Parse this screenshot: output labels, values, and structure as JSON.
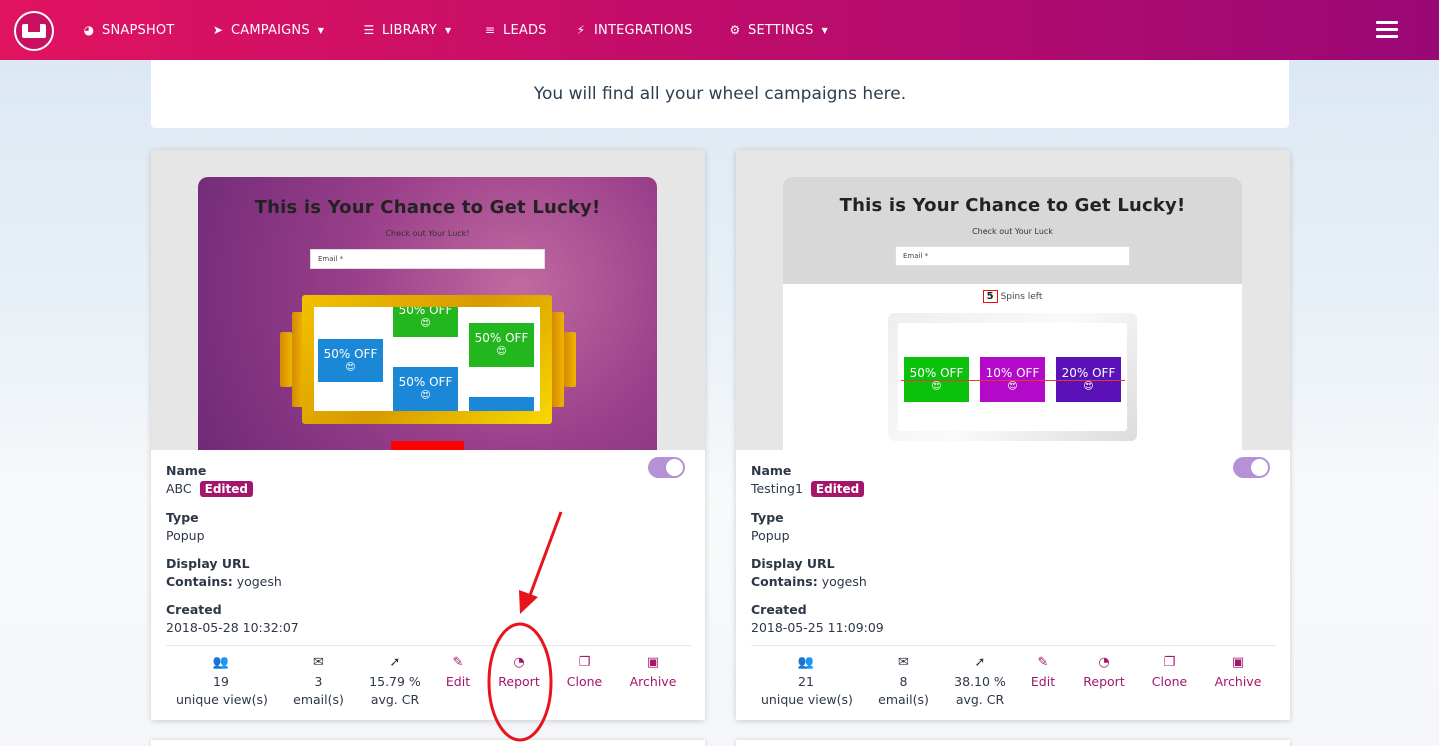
{
  "nav": {
    "items": [
      {
        "label": "SNAPSHOT",
        "icon": "dashboard-icon"
      },
      {
        "label": "CAMPAIGNS",
        "icon": "paper-plane-icon"
      },
      {
        "label": "LIBRARY",
        "icon": "server-icon"
      },
      {
        "label": "LEADS",
        "icon": "list-icon"
      },
      {
        "label": "INTEGRATIONS",
        "icon": "plug-icon"
      },
      {
        "label": "SETTINGS",
        "icon": "cogs-icon"
      }
    ]
  },
  "banner": {
    "text": "You will find all your wheel campaigns here."
  },
  "labels": {
    "name": "Name",
    "type": "Type",
    "display_url": "Display URL",
    "contains": "Contains:",
    "created": "Created",
    "edited": "Edited"
  },
  "cards": [
    {
      "name": "ABC",
      "type": "Popup",
      "contains": "yogesh",
      "created": "2018-05-28 10:32:07",
      "enabled": true,
      "preview": {
        "title": "This is Your Chance to Get Lucky!",
        "subtitle": "Check out Your Luck!",
        "email_placeholder": "Email *",
        "prizes": [
          "50% OFF",
          "50% OFF",
          "50% OFF",
          "50% OFF"
        ],
        "emoji": "😍"
      },
      "stats": {
        "views": "19",
        "views_label": "unique view(s)",
        "emails": "3",
        "emails_label": "email(s)",
        "cr": "15.79 %",
        "cr_label": "avg. CR"
      }
    },
    {
      "name": "Testing1",
      "type": "Popup",
      "contains": "yogesh",
      "created": "2018-05-25 11:09:09",
      "enabled": true,
      "preview": {
        "title": "This is Your Chance to Get Lucky!",
        "subtitle": "Check out Your Luck",
        "email_placeholder": "Email *",
        "spins_count": "5",
        "spins_label": "Spins left",
        "prizes": [
          "50% OFF",
          "10% OFF",
          "20% OFF"
        ],
        "emoji": "😍"
      },
      "stats": {
        "views": "21",
        "views_label": "unique view(s)",
        "emails": "8",
        "emails_label": "email(s)",
        "cr": "38.10 %",
        "cr_label": "avg. CR"
      }
    }
  ],
  "actions": {
    "edit": "Edit",
    "report": "Report",
    "clone": "Clone",
    "archive": "Archive"
  },
  "colors": {
    "nav_start": "#e0135f",
    "nav_end": "#9a0876",
    "accent": "#a3166a",
    "toggle": "#b592d6",
    "annotation": "#e8141c"
  }
}
